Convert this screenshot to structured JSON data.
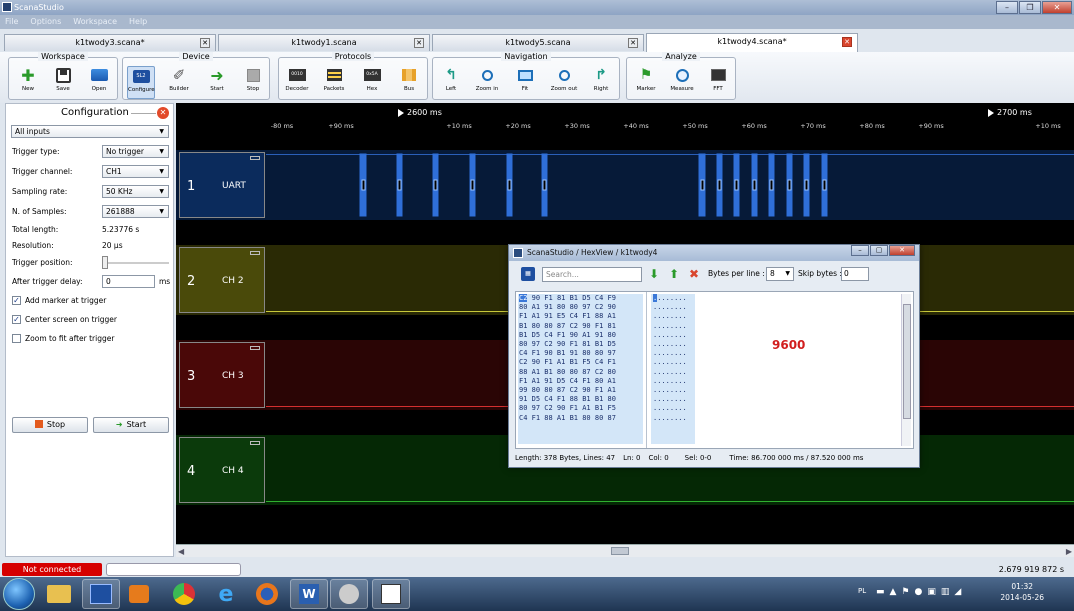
{
  "app": {
    "title": "ScanaStudio"
  },
  "menu": [
    "File",
    "Options",
    "Workspace",
    "Help"
  ],
  "tabs": [
    {
      "label": "k1twody3.scana*"
    },
    {
      "label": "k1twody1.scana"
    },
    {
      "label": "k1twody5.scana"
    },
    {
      "label": "k1twody4.scana*"
    }
  ],
  "toolbar": {
    "groups": {
      "workspace": "Workspace",
      "device": "Device",
      "protocols": "Protocols",
      "navigation": "Navigation",
      "analyze": "Analyze"
    },
    "buttons": {
      "new": "New",
      "save": "Save",
      "open": "Open",
      "configure": "Configure",
      "builder": "Builder",
      "start": "Start",
      "stop": "Stop",
      "decoder": "Decoder",
      "packets": "Packets",
      "hex": "Hex",
      "bus": "Bus",
      "left": "Left",
      "zoom_in": "Zoom in",
      "fit": "Fit",
      "zoom_out": "Zoom out",
      "right": "Right",
      "marker": "Marker",
      "measure": "Measure",
      "fft": "FFT"
    },
    "icon_text": {
      "configure": "SL2",
      "decoder": "0010",
      "hex": "0x5A"
    }
  },
  "config": {
    "title": "Configuration",
    "inputs": "All inputs",
    "trigger_type_label": "Trigger type:",
    "trigger_type": "No trigger",
    "trigger_channel_label": "Trigger channel:",
    "trigger_channel": "CH1",
    "sampling_rate_label": "Sampling rate:",
    "sampling_rate": "50 KHz",
    "samples_label": "N. of Samples:",
    "samples": "261888",
    "total_length_label": "Total length:",
    "total_length": "5.23776 s",
    "resolution_label": "Resolution:",
    "resolution": "20 µs",
    "trigger_position_label": "Trigger position:",
    "after_delay_label": "After trigger delay:",
    "after_delay": "0",
    "after_delay_unit": "ms",
    "chk_marker": "Add marker at trigger",
    "chk_center": "Center screen on trigger",
    "chk_zoom": "Zoom to fit after trigger",
    "stop_label": "Stop",
    "start_label": "Start"
  },
  "ruler": {
    "marker_left": "2600 ms",
    "marker_right": "2700 ms",
    "ticks": [
      "-80 ms",
      "+90 ms",
      "+10 ms",
      "+20 ms",
      "+30 ms",
      "+40 ms",
      "+50 ms",
      "+60 ms",
      "+70 ms",
      "+80 ms",
      "+90 ms",
      "+10 ms"
    ]
  },
  "channels": [
    {
      "num": "1",
      "name": "UART",
      "color": "#0b2b5c",
      "line": "#3a7be0"
    },
    {
      "num": "2",
      "name": "CH 2",
      "color": "#4a4a0a",
      "line": "#c8c83a"
    },
    {
      "num": "3",
      "name": "CH 3",
      "color": "#4a0808",
      "line": "#d43030"
    },
    {
      "num": "4",
      "name": "CH 4",
      "color": "#0b3a0b",
      "line": "#2fb02f"
    }
  ],
  "hexview": {
    "title": "ScanaStudio / HexView / k1twody4",
    "search_placeholder": "Search...",
    "bytes_per_line_label": "Bytes per line :",
    "bytes_per_line": "8",
    "skip_label": "Skip bytes :",
    "skip_value": "0",
    "rows": [
      "C2 90 F1 81 B1 D5 C4 F9",
      "80 A1 91 80 80 97 C2 90",
      "F1 A1 91 E5 C4 F1 88 A1",
      "B1 80 80 87 C2 90 F1 81",
      "B1 D5 C4 F1 90 A1 91 80",
      "80 97 C2 90 F1 81 B1 D5",
      "C4 F1 90 B1 91 80 80 97",
      "C2 90 F1 A1 B1 F5 C4 F1",
      "88 A1 B1 80 80 87 C2 80",
      "F1 A1 91 D5 C4 F1 80 A1",
      "99 80 80 87 C2 90 F1 A1",
      "91 D5 C4 F1 88 B1 B1 80",
      "80 97 C2 90 F1 A1 B1 F5",
      "C4 F1 88 A1 B1 80 80 87"
    ],
    "ascii_row": "........",
    "annotation": "9600",
    "status": {
      "length": "Length: 378 Bytes, Lines: 47",
      "ln": "Ln: 0",
      "col": "Col: 0",
      "sel": "Sel: 0-0",
      "time": "Time: 86.700 000 ms / 87.520 000 ms"
    }
  },
  "status": {
    "connection": "Not connected",
    "cursor_time": "2.679 919 872 s"
  },
  "tray": {
    "lang": "PL",
    "time": "01:32",
    "date": "2014-05-26"
  }
}
